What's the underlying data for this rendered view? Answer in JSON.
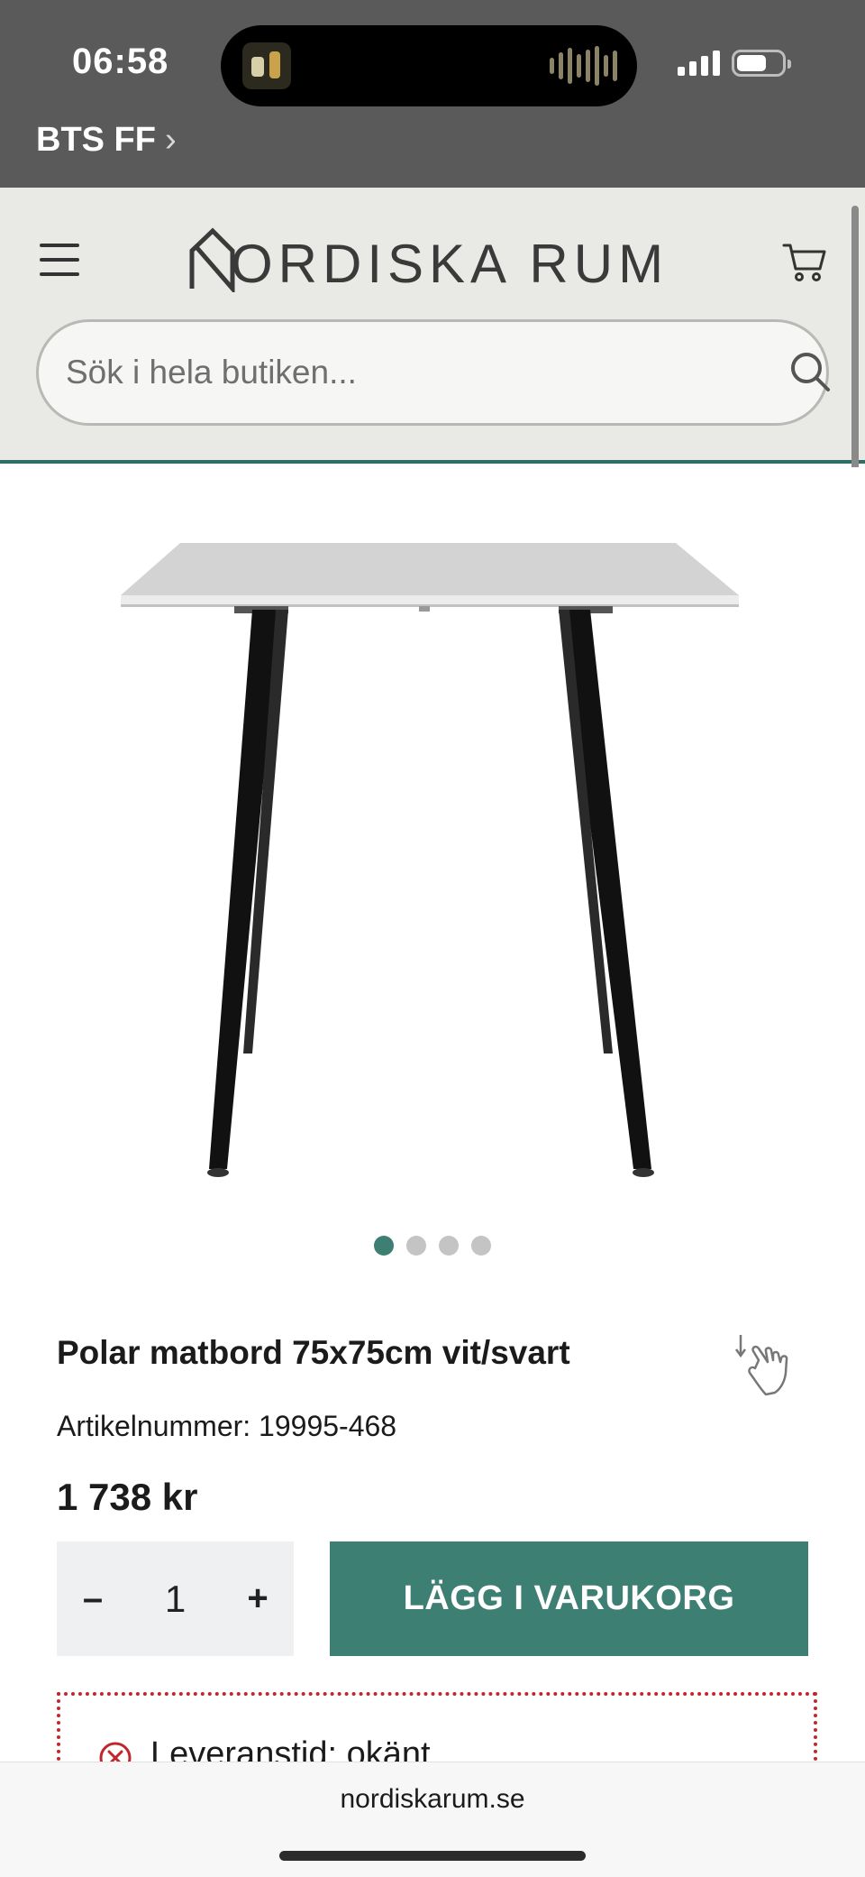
{
  "status_bar": {
    "time": "06:58",
    "back_app": "BTS FF",
    "back_chevron": "›",
    "icons": [
      "now-playing-art",
      "audio-waveform-icon",
      "cellular-signal-icon",
      "battery-icon"
    ]
  },
  "header": {
    "logo_text": "ORDISKA RUM",
    "search_placeholder": "Sök i hela butiken...",
    "icons": [
      "hamburger-menu-icon",
      "nordiska-rum-logo",
      "cart-icon",
      "search-icon"
    ],
    "accent_color": "#2f6e66"
  },
  "gallery": {
    "image_alt": "Polar matbord 75x75cm vit/svart",
    "slide_count": 4,
    "active_slide": 1
  },
  "product": {
    "title": "Polar matbord 75x75cm vit/svart",
    "sku": "Artikelnummer: 19995-468",
    "price": "1 738 kr",
    "quantity": "1",
    "minus_label": "–",
    "plus_label": "+",
    "add_to_cart_label": "LÄGG I VARUKORG",
    "button_color": "#3e7f73",
    "delivery": "Leveranstid: okänt",
    "delivery_color": "#c0272d"
  },
  "browser": {
    "url": "nordiskarum.se"
  }
}
